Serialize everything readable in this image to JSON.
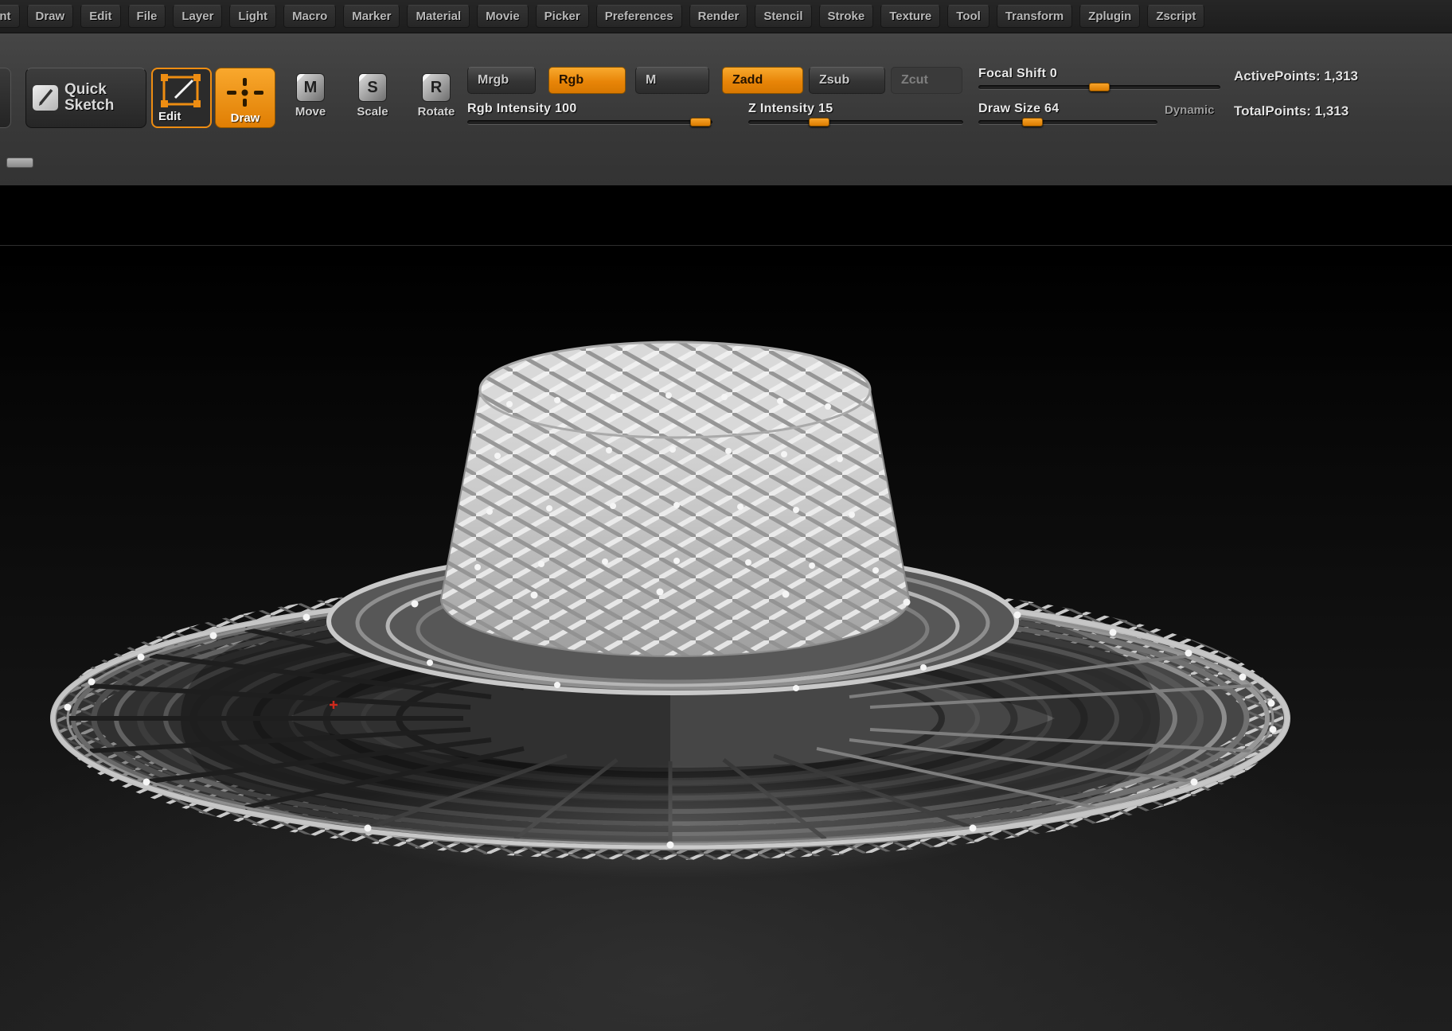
{
  "menu": {
    "items": [
      "ent",
      "Draw",
      "Edit",
      "File",
      "Layer",
      "Light",
      "Macro",
      "Marker",
      "Material",
      "Movie",
      "Picker",
      "Preferences",
      "Render",
      "Stencil",
      "Stroke",
      "Texture",
      "Tool",
      "Transform",
      "Zplugin",
      "Zscript"
    ]
  },
  "toolbar": {
    "quick_sketch_label": "Quick Sketch",
    "edit_label": "Edit",
    "draw_label": "Draw",
    "move_label": "Move",
    "scale_label": "Scale",
    "rotate_label": "Rotate",
    "move_icon_letter": "M",
    "scale_icon_letter": "S",
    "rotate_icon_letter": "R",
    "mrgb_label": "Mrgb",
    "rgb_label": "Rgb",
    "m_label": "M",
    "zadd_label": "Zadd",
    "zsub_label": "Zsub",
    "zcut_label": "Zcut",
    "sliders": {
      "rgb_intensity": {
        "label": "Rgb Intensity 100",
        "value": 100,
        "fraction": 0.95
      },
      "z_intensity": {
        "label": "Z Intensity 15",
        "value": 15,
        "fraction": 0.33
      },
      "focal_shift": {
        "label": "Focal Shift 0",
        "value": 0,
        "fraction": 0.5
      },
      "draw_size": {
        "label": "Draw Size 64",
        "value": 64,
        "fraction": 0.3
      }
    },
    "dynamic_label": "Dynamic",
    "stats": {
      "active_points": "ActivePoints: 1,313",
      "total_points": "TotalPoints: 1,313"
    }
  },
  "colors": {
    "accent_orange": "#ee8d12",
    "toolbar_bg": "#3c3c3c",
    "menubar_bg": "#222222",
    "canvas_bg": "#000000"
  }
}
